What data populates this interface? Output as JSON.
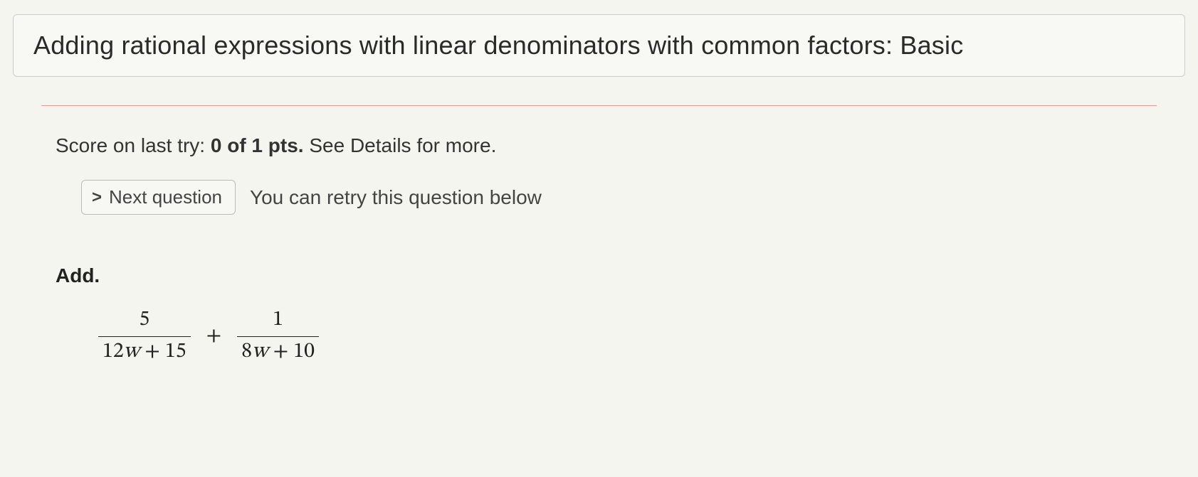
{
  "title": "Adding rational expressions with linear denominators with common factors: Basic",
  "score": {
    "prefix": "Score on last try: ",
    "value": "0 of 1 pts.",
    "suffix": " See Details for more."
  },
  "next_button": {
    "chevron": ">",
    "label": "Next question"
  },
  "retry_text": "You can retry this question below",
  "problem": {
    "instruction": "Add.",
    "frac1_num": "5",
    "frac1_den_a": "12",
    "frac1_den_var": "w",
    "frac1_den_b": " + 15",
    "plus": "+",
    "frac2_num": "1",
    "frac2_den_a": "8",
    "frac2_den_var": "w",
    "frac2_den_b": " + 10"
  }
}
